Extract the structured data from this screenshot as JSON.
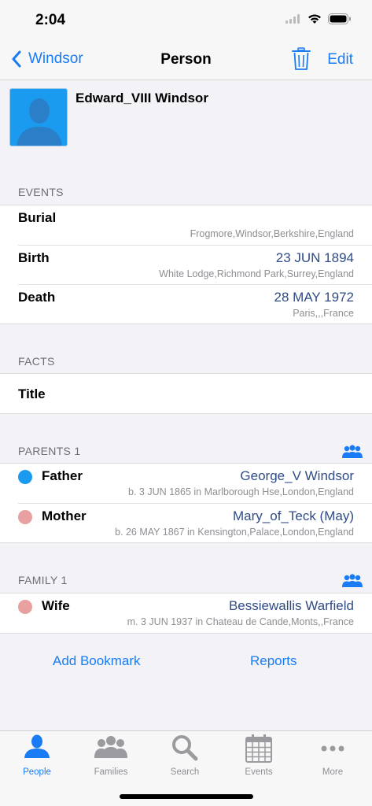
{
  "status_bar": {
    "time": "2:04"
  },
  "nav": {
    "back_label": "Windsor",
    "title": "Person",
    "edit_label": "Edit"
  },
  "person": {
    "name": "Edward_VIII  Windsor"
  },
  "events": {
    "header": "EVENTS",
    "items": [
      {
        "title": "Burial",
        "value": "",
        "sub": "Frogmore,Windsor,Berkshire,England"
      },
      {
        "title": "Birth",
        "value": "23 JUN 1894",
        "sub": "White Lodge,Richmond Park,Surrey,England"
      },
      {
        "title": "Death",
        "value": "28 MAY 1972",
        "sub": "Paris,,,France"
      }
    ]
  },
  "facts": {
    "header": "FACTS",
    "items": [
      {
        "title": "Title"
      }
    ]
  },
  "parents": {
    "header": "PARENTS 1",
    "items": [
      {
        "title": "Father",
        "value": "George_V  Windsor",
        "sub": "b. 3 JUN 1865 in Marlborough Hse,London,England",
        "dot_color": "#1a9bf0"
      },
      {
        "title": "Mother",
        "value": "Mary_of_Teck (May)",
        "sub": "b. 26 MAY 1867 in Kensington,Palace,London,England",
        "dot_color": "#e8a0a0"
      }
    ]
  },
  "family": {
    "header": "FAMILY 1",
    "items": [
      {
        "title": "Wife",
        "value": "Bessiewallis  Warfield",
        "sub": "m. 3 JUN 1937 in Chateau de Cande,Monts,,France",
        "dot_color": "#e8a0a0"
      }
    ]
  },
  "actions": {
    "bookmark_label": "Add Bookmark",
    "reports_label": "Reports"
  },
  "tabs": [
    {
      "label": "People",
      "icon": "person-icon",
      "active": true
    },
    {
      "label": "Families",
      "icon": "families-icon",
      "active": false
    },
    {
      "label": "Search",
      "icon": "search-icon",
      "active": false
    },
    {
      "label": "Events",
      "icon": "calendar-icon",
      "active": false
    },
    {
      "label": "More",
      "icon": "more-icon",
      "active": false
    }
  ],
  "colors": {
    "accent": "#1a7cf5",
    "value_text": "#304b86",
    "secondary_text": "#8e8e93",
    "background": "#f2f2f7"
  }
}
